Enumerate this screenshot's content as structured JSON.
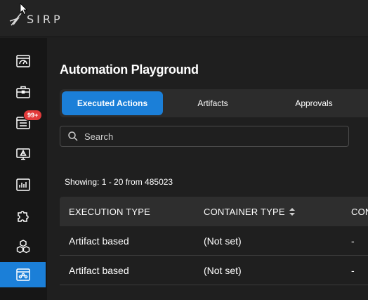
{
  "app": {
    "logo_text": "SIRP"
  },
  "sidebar": {
    "items": [
      {
        "name": "dashboard",
        "icon": "dashboard-icon"
      },
      {
        "name": "cases",
        "icon": "briefcase-icon"
      },
      {
        "name": "incidents",
        "icon": "list-icon",
        "badge": "99+"
      },
      {
        "name": "alerts",
        "icon": "monitor-alert-icon"
      },
      {
        "name": "reports",
        "icon": "chart-icon"
      },
      {
        "name": "integrations",
        "icon": "puzzle-icon"
      },
      {
        "name": "assets",
        "icon": "cubes-icon"
      },
      {
        "name": "automation-playground",
        "icon": "automation-icon",
        "active": true
      }
    ]
  },
  "page": {
    "title": "Automation Playground"
  },
  "tabs": [
    {
      "label": "Executed Actions",
      "active": true
    },
    {
      "label": "Artifacts",
      "active": false
    },
    {
      "label": "Approvals",
      "active": false
    }
  ],
  "search": {
    "placeholder": "Search",
    "value": ""
  },
  "pagination": {
    "showing": "Showing: 1 - 20 from 485023"
  },
  "table": {
    "columns": [
      "EXECUTION TYPE",
      "CONTAINER TYPE",
      "CON"
    ],
    "rows": [
      [
        "Artifact based",
        "(Not set)",
        "-"
      ],
      [
        "Artifact based",
        "(Not set)",
        "-"
      ]
    ]
  },
  "colors": {
    "accent": "#1b7fd8",
    "badge": "#e23b3b",
    "background": "#1f1f1f",
    "sidebar": "#161616"
  }
}
